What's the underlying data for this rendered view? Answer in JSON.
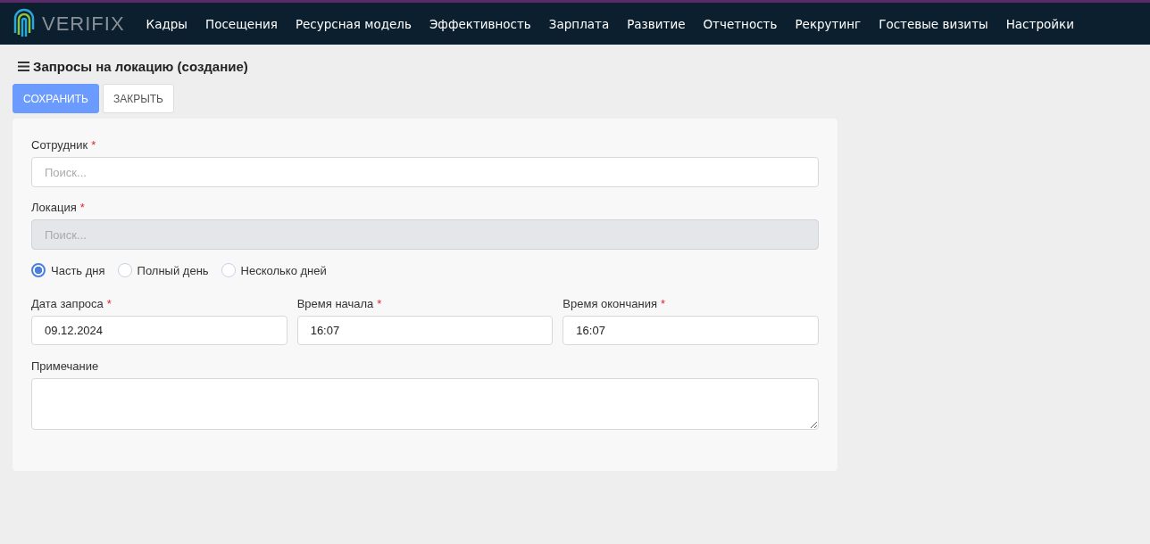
{
  "logo": {
    "text": "VERIFIX"
  },
  "nav": [
    "Кадры",
    "Посещения",
    "Ресурсная модель",
    "Эффективность",
    "Зарплата",
    "Развитие",
    "Отчетность",
    "Рекрутинг",
    "Гостевые визиты",
    "Настройки"
  ],
  "page_title": "Запросы на локацию (создание)",
  "buttons": [
    {
      "label": "СОХРАНИТЬ",
      "kind": "primary"
    },
    {
      "label": "ЗАКРЫТЬ",
      "kind": "secondary"
    }
  ],
  "fields": [
    {
      "label": "Сотрудник",
      "mark": "*",
      "placeholder": "Поиск...",
      "disabled": false
    },
    {
      "label": "Локация",
      "mark": "*",
      "placeholder": "Поиск...",
      "disabled": true
    }
  ],
  "day_options": [
    {
      "label": "Часть дня",
      "selected": true
    },
    {
      "label": "Полный день",
      "selected": false
    },
    {
      "label": "Несколько дней",
      "selected": false
    }
  ],
  "time_fields": [
    {
      "label": "Дата запроса",
      "mark": "*",
      "value": "09.12.2024"
    },
    {
      "label": "Время начала",
      "mark": "*",
      "value": "16:07"
    },
    {
      "label": "Время окончания",
      "mark": "*",
      "value": "16:07"
    }
  ],
  "note": {
    "label": "Примечание"
  }
}
